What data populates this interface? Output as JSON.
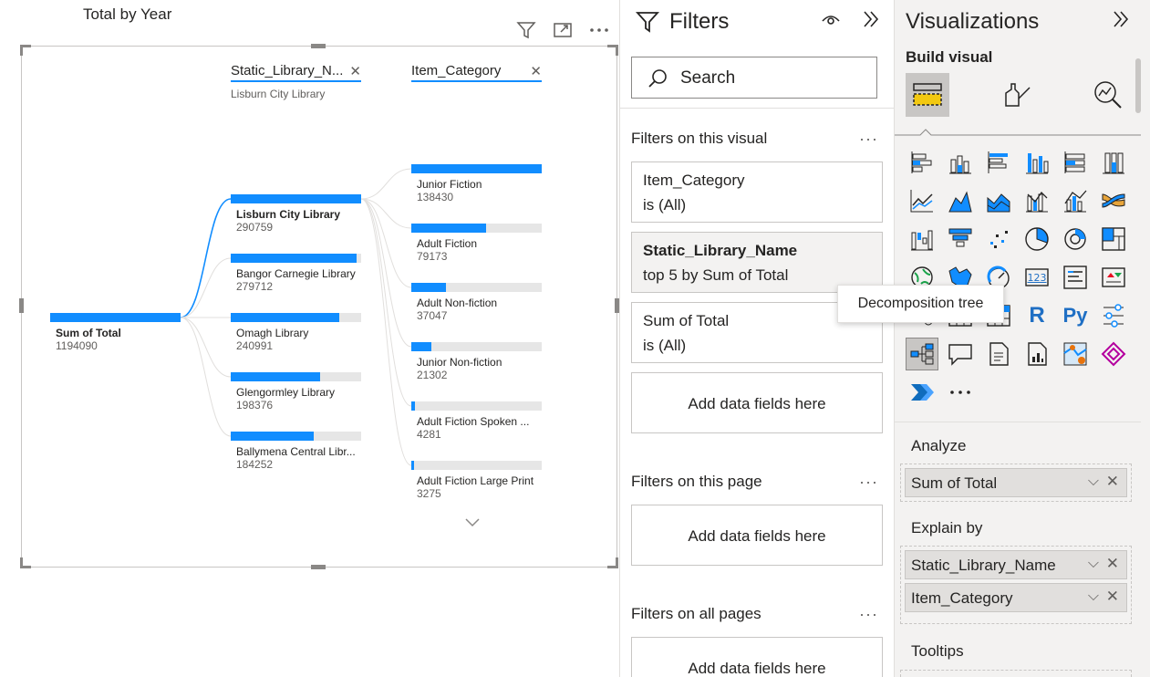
{
  "visual": {
    "title": "Total by Year",
    "levels": [
      {
        "header": "",
        "subtitle": ""
      },
      {
        "header": "Static_Library_N...",
        "subtitle": "Lisburn City Library"
      },
      {
        "header": "Item_Category",
        "subtitle": ""
      }
    ],
    "root": {
      "label": "Sum of Total",
      "value": "1194090",
      "fill": 1.0
    },
    "libraries": [
      {
        "label": "Lisburn City Library",
        "value": "290759",
        "fill": 1.0
      },
      {
        "label": "Bangor Carnegie Library",
        "value": "279712",
        "fill": 0.962
      },
      {
        "label": "Omagh Library",
        "value": "240991",
        "fill": 0.829
      },
      {
        "label": "Glengormley Library",
        "value": "198376",
        "fill": 0.682
      },
      {
        "label": "Ballymena Central Libr...",
        "value": "184252",
        "fill": 0.634
      }
    ],
    "categories": [
      {
        "label": "Junior Fiction",
        "value": "138430",
        "fill": 1.0
      },
      {
        "label": "Adult Fiction",
        "value": "79173",
        "fill": 0.572
      },
      {
        "label": "Adult Non-fiction",
        "value": "37047",
        "fill": 0.268
      },
      {
        "label": "Junior Non-fiction",
        "value": "21302",
        "fill": 0.154
      },
      {
        "label": "Adult Fiction Spoken ...",
        "value": "4281",
        "fill": 0.031
      },
      {
        "label": "Adult Fiction Large Print",
        "value": "3275",
        "fill": 0.024
      }
    ]
  },
  "filters": {
    "title": "Filters",
    "search_placeholder": "Search",
    "section_visual": "Filters on this visual",
    "section_page": "Filters on this page",
    "section_all": "Filters on all pages",
    "dots": "···",
    "cards": [
      {
        "line1": "Item_Category",
        "line2": "is (All)"
      },
      {
        "line1": "Static_Library_Name",
        "line2": "top 5 by Sum of Total"
      },
      {
        "line1": "Sum of Total",
        "line2": "is (All)"
      }
    ],
    "add_fields": "Add data fields here",
    "tooltip": "Decomposition tree"
  },
  "viz": {
    "title": "Visualizations",
    "build_visual": "Build visual",
    "more": "···",
    "analyze_label": "Analyze",
    "analyze_pill": "Sum of Total",
    "explain_label": "Explain by",
    "explain_pills": [
      "Static_Library_Name",
      "Item_Category"
    ],
    "tooltips_label": "Tooltips",
    "r_label": "R",
    "py_label": "Py",
    "kpi_label": "123"
  },
  "colors": {
    "accent": "#118dff",
    "track": "#e6e6e6",
    "pane_bg": "#f3f2f1",
    "text": "#252423",
    "subtext": "#605e5c"
  }
}
